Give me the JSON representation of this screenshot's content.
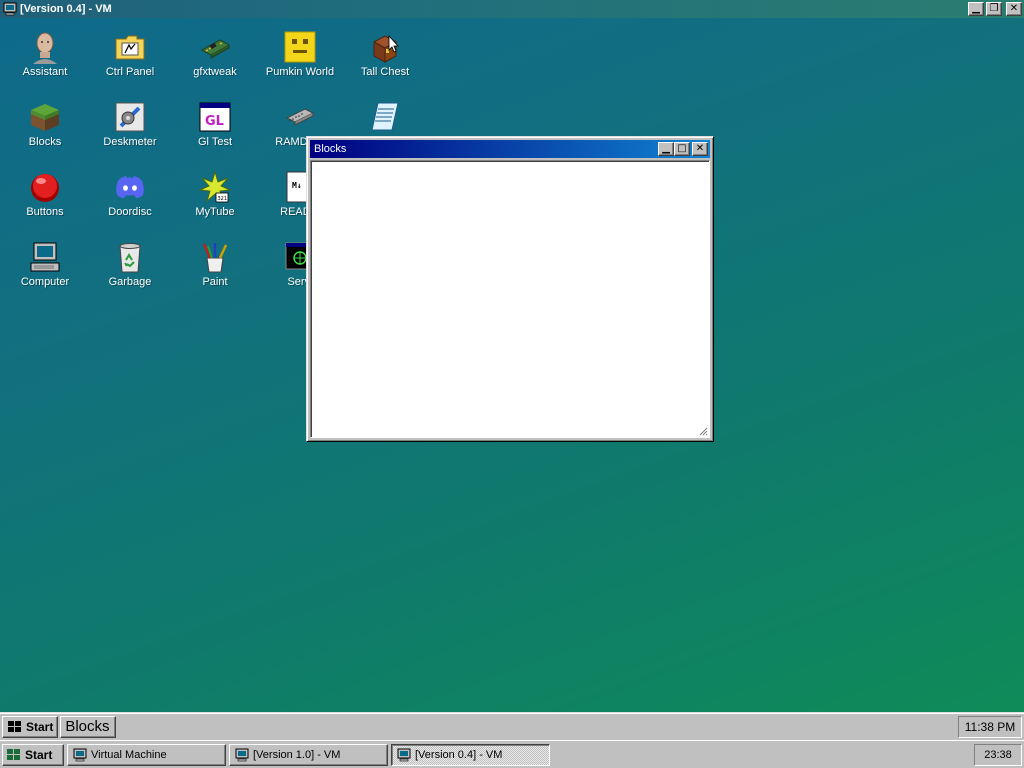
{
  "host_window": {
    "title": "[Version 0.4] - VM",
    "icon": "computer-icon",
    "controls": [
      "minimize-icon",
      "restore-icon",
      "close-icon"
    ]
  },
  "desktop": {
    "icons": [
      {
        "label": "Assistant",
        "icon": "assistant-head-icon"
      },
      {
        "label": "Ctrl Panel",
        "icon": "control-panel-folder-icon"
      },
      {
        "label": "gfxtweak",
        "icon": "graphics-card-icon"
      },
      {
        "label": "Pumkin World",
        "icon": "pumpkin-face-icon"
      },
      {
        "label": "Tall Chest",
        "icon": "chest-icon"
      },
      {
        "label": "Blocks",
        "icon": "grass-block-icon"
      },
      {
        "label": "Deskmeter",
        "icon": "deskmeter-icon"
      },
      {
        "label": "Gl Test",
        "icon": "gl-window-icon"
      },
      {
        "label": "RAMD (E:",
        "icon": "ram-chip-icon"
      },
      {
        "label": "",
        "icon": "notepad-icon"
      },
      {
        "label": "Buttons",
        "icon": "red-button-icon"
      },
      {
        "label": "Doordisc",
        "icon": "discord-icon"
      },
      {
        "label": "MyTube",
        "icon": "mytube-starburst-icon"
      },
      {
        "label": "READM",
        "icon": "readme-icon"
      },
      {
        "label": "Computer",
        "icon": "computer-icon"
      },
      {
        "label": "Garbage",
        "icon": "recycle-bin-icon"
      },
      {
        "label": "Paint",
        "icon": "paint-brushes-icon"
      },
      {
        "label": "Servi",
        "icon": "services-terminal-icon"
      }
    ]
  },
  "blocks_window": {
    "title": "Blocks",
    "controls": [
      "minimize-icon",
      "maximize-icon",
      "close-icon"
    ]
  },
  "guest_taskbar": {
    "start_label": "Start",
    "tasks": [
      {
        "label": "Blocks"
      }
    ],
    "clock": "11:38 PM"
  },
  "host_taskbar": {
    "start_label": "Start",
    "tasks": [
      {
        "label": "Virtual Machine",
        "active": false
      },
      {
        "label": "[Version 1.0] - VM",
        "active": false
      },
      {
        "label": "[Version 0.4] - VM",
        "active": true
      }
    ],
    "clock": "23:38"
  },
  "colors": {
    "desktop_top": "#0e6a8a",
    "desktop_bottom": "#0f8b58",
    "titlebar_active": "#000080",
    "face": "#c0c0c0"
  }
}
